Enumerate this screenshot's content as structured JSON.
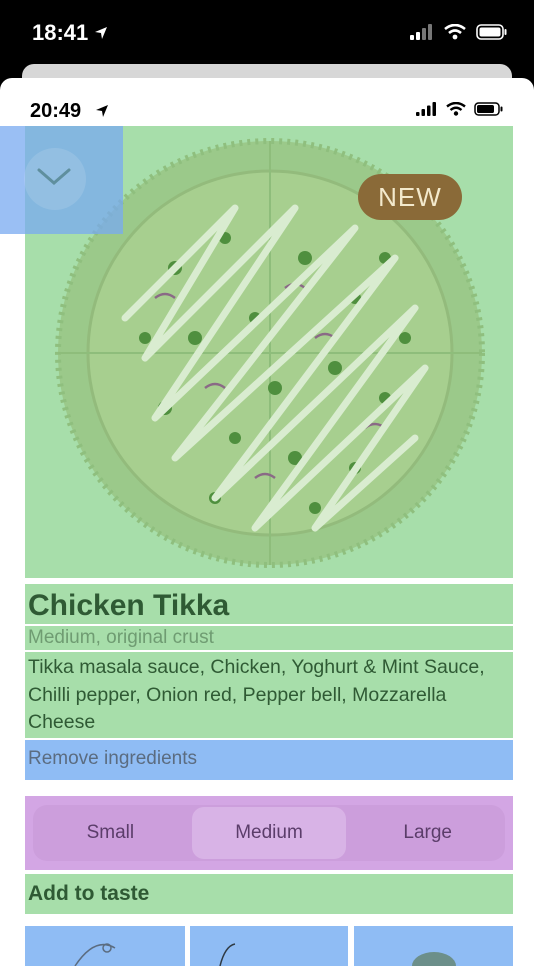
{
  "system_status": {
    "time": "18:41"
  },
  "app_status": {
    "time": "20:49"
  },
  "product": {
    "badge": "NEW",
    "name": "Chicken Tikka",
    "variant": "Medium, original crust",
    "ingredients": "Tikka masala sauce, Chicken, Yoghurt & Mint Sauce, Chilli pepper, Onion red, Pepper bell, Mozzarella Cheese",
    "remove_label": "Remove ingredients"
  },
  "sizes": {
    "options": [
      "Small",
      "Medium",
      "Large"
    ],
    "selected": "Medium"
  },
  "add_to_taste": {
    "title": "Add to taste"
  },
  "colors": {
    "overlay_green": "#a7deaa",
    "overlay_blue": "#8fbcf4",
    "overlay_purple": "#d3a6e4",
    "badge_brown": "#8a6a38"
  },
  "icons": {
    "collapse": "chevron-down-icon",
    "location": "location-arrow-icon",
    "signal": "cellular-signal-icon",
    "wifi": "wifi-icon",
    "battery": "battery-icon"
  }
}
